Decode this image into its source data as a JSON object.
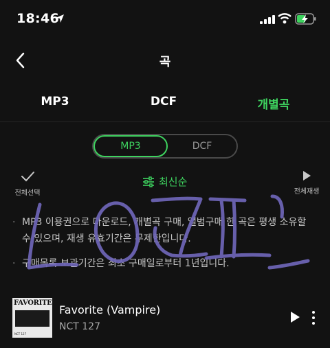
{
  "status_bar": {
    "time": "18:46"
  },
  "header": {
    "title": "곡"
  },
  "tabs": [
    {
      "label": "MP3"
    },
    {
      "label": "DCF"
    },
    {
      "label": "개별곡"
    }
  ],
  "segment": {
    "active": "MP3",
    "inactive": "DCF"
  },
  "toolbar": {
    "select_all": "전체선택",
    "sort": "최신순",
    "play_all": "전체재생"
  },
  "notes": [
    "MP3 이용권으로 다운로드, 개별곡 구매, 앨범구매 한 곡은 평생 소유할 수 있으며, 재생 유효기간은 무제한입니다.",
    "구매목록 보관기간은 최초 구매일로부터 1년입니다."
  ],
  "track": {
    "title": "Favorite (Vampire)",
    "artist": "NCT 127",
    "cover_text": "FAVORITE",
    "cover_small": "NCT 127"
  },
  "colors": {
    "accent": "#3ed35f",
    "background": "#121212"
  }
}
